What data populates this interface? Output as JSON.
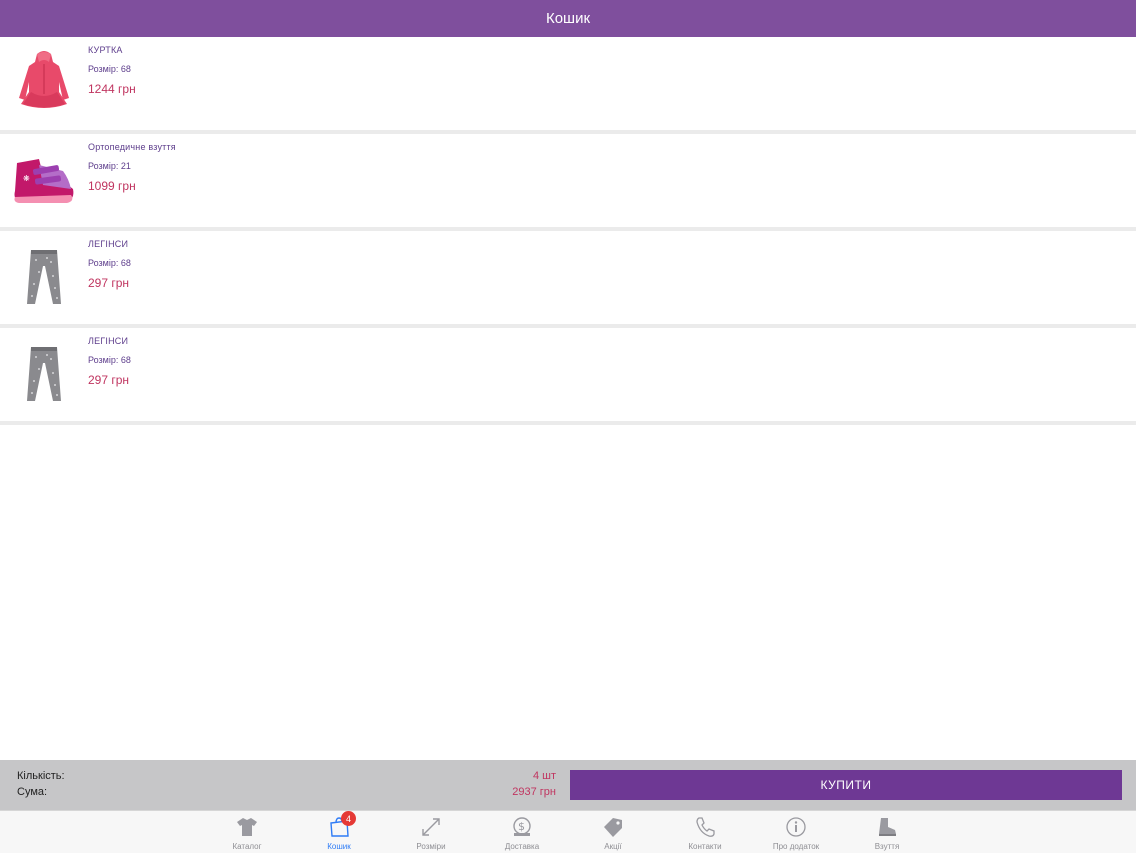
{
  "header": {
    "title": "Кошик"
  },
  "cart": {
    "items": [
      {
        "name": "КУРТКА",
        "size": "Розмір: 68",
        "price": "1244 грн",
        "image": "pink-jacket"
      },
      {
        "name": "Ортопедичне взуття",
        "size": "Розмір: 21",
        "price": "1099 грн",
        "image": "pink-orthopedic-shoe"
      },
      {
        "name": "ЛЕГІНСИ",
        "size": "Розмір: 68",
        "price": "297 грн",
        "image": "grey-leggings"
      },
      {
        "name": "ЛЕГІНСИ",
        "size": "Розмір: 68",
        "price": "297 грн",
        "image": "grey-leggings"
      }
    ]
  },
  "summary": {
    "quantity_label": "Кількість:",
    "sum_label": "Сума:",
    "quantity_value": "4 шт",
    "sum_value": "2937 грн",
    "buy_label": "КУПИТИ"
  },
  "tabs": [
    {
      "label": "Каталог",
      "icon": "shirt-icon"
    },
    {
      "label": "Кошик",
      "icon": "shopping-bag-icon",
      "badge": "4",
      "active": true
    },
    {
      "label": "Розміри",
      "icon": "resize-arrows-icon"
    },
    {
      "label": "Доставка",
      "icon": "dollar-truck-icon"
    },
    {
      "label": "Акції",
      "icon": "tag-icon"
    },
    {
      "label": "Контакти",
      "icon": "phone-icon"
    },
    {
      "label": "Про додаток",
      "icon": "info-icon"
    },
    {
      "label": "Взуття",
      "icon": "boot-icon"
    }
  ],
  "colors": {
    "header": "#7f4f9d",
    "buy_button": "#6e3894",
    "price": "#c03560",
    "active_tab": "#2f7cf6"
  }
}
